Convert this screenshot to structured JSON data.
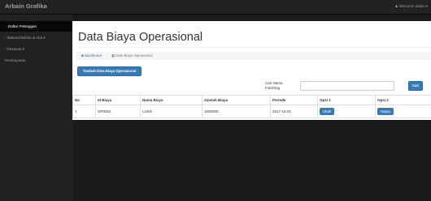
{
  "header": {
    "brand": "Arbain Grafika",
    "welcome": "Welcome dailyo"
  },
  "sidebar": {
    "items": [
      {
        "label": "Daftar Pelanggan"
      },
      {
        "label": "Material Bahan & Alat"
      },
      {
        "label": "Pesanan"
      },
      {
        "label": "Pembayaran"
      }
    ]
  },
  "main": {
    "title": "Data Biaya Operasional",
    "breadcrumb": {
      "home": "Dashboard",
      "current": "Data Biaya Operasional"
    },
    "add_button": "Tambah Data Biaya Operasional",
    "search": {
      "label_line1": "Cari Nama",
      "label_line2": "Finishing",
      "value": "",
      "button": "Cari"
    },
    "table": {
      "headers": [
        "No",
        "Id Biaya",
        "Nama Biaya",
        "Jumlah Biaya",
        "Periode",
        "Opsi 1",
        "Opsi 2"
      ],
      "rows": [
        {
          "no": "1",
          "id": "OP0001",
          "nama": "Listrik",
          "jumlah": "1000000",
          "periode": "2017-12-01",
          "opsi1": "Ubah",
          "opsi2": "Hapus"
        }
      ]
    }
  },
  "colors": {
    "accent": "#337ab7",
    "navbar": "#222222"
  }
}
